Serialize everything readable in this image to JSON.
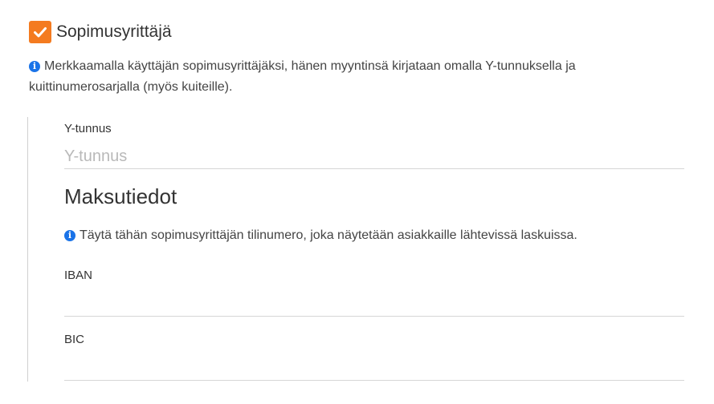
{
  "contract": {
    "checkbox_label": "Sopimusyrittäjä",
    "checked": true,
    "info": "Merkkaamalla käyttäjän sopimusyrittäjäksi, hänen myyntinsä kirjataan omalla Y-tunnuksella ja kuittinumerosarjalla (myös kuiteille)."
  },
  "fields": {
    "ytunnus": {
      "label": "Y-tunnus",
      "value": "",
      "placeholder": "Y-tunnus"
    },
    "iban": {
      "label": "IBAN",
      "value": "",
      "placeholder": ""
    },
    "bic": {
      "label": "BIC",
      "value": "",
      "placeholder": ""
    }
  },
  "payment": {
    "heading": "Maksutiedot",
    "info": "Täytä tähän sopimusyrittäjän tilinumero, joka näytetään asiakkaille lähtevissä laskuissa."
  },
  "icons": {
    "checkbox": "check-icon",
    "info": "info-icon"
  },
  "colors": {
    "accent": "#f47b20",
    "info": "#1a73e8"
  }
}
